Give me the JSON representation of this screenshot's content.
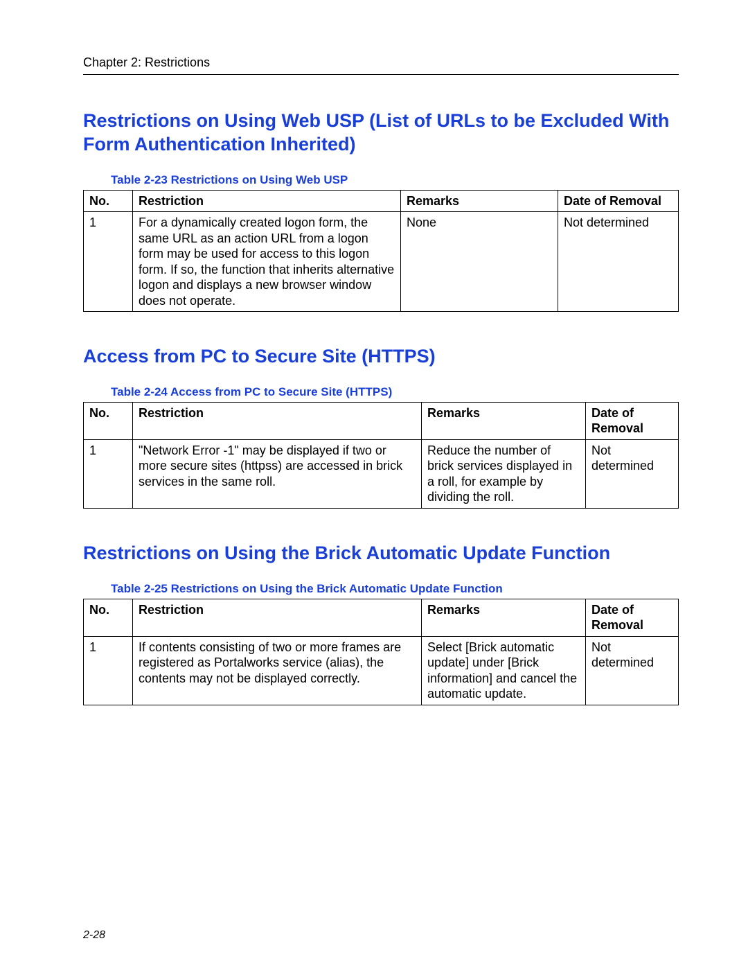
{
  "chapter": "Chapter 2:  Restrictions",
  "page_number": "2-28",
  "table_headers": {
    "no": "No.",
    "restriction": "Restriction",
    "remarks": "Remarks",
    "date": "Date of Removal"
  },
  "section1": {
    "title": "Restrictions on Using Web USP (List of URLs to be Excluded With Form Authentication Inherited)",
    "caption": "Table 2-23  Restrictions on Using Web USP",
    "row": {
      "no": "1",
      "restriction": "For a dynamically created logon form, the same URL as an action URL from a logon form may be used for access to this logon form.  If so, the function that inherits alternative logon and displays a new browser window does not operate.",
      "remarks": "None",
      "date": "Not determined"
    }
  },
  "section2": {
    "title": "Access from PC to Secure Site (HTTPS)",
    "caption": "Table 2-24  Access from PC to Secure Site (HTTPS)",
    "row": {
      "no": "1",
      "restriction": "\"Network Error -1\" may be displayed if two or more secure sites (httpss) are accessed in brick services in the same roll.",
      "remarks": "Reduce the number of brick services displayed in a roll, for example by dividing the roll.",
      "date": "Not determined"
    }
  },
  "section3": {
    "title": "Restrictions on Using the Brick Automatic Update Function",
    "caption": "Table 2-25  Restrictions on Using the Brick Automatic Update Function",
    "row": {
      "no": "1",
      "restriction": "If contents consisting of two or more frames are registered as Portalworks service (alias), the contents may not be displayed correctly.",
      "remarks": "Select [Brick automatic update] under [Brick information] and cancel the automatic update.",
      "date": "Not determined"
    }
  }
}
